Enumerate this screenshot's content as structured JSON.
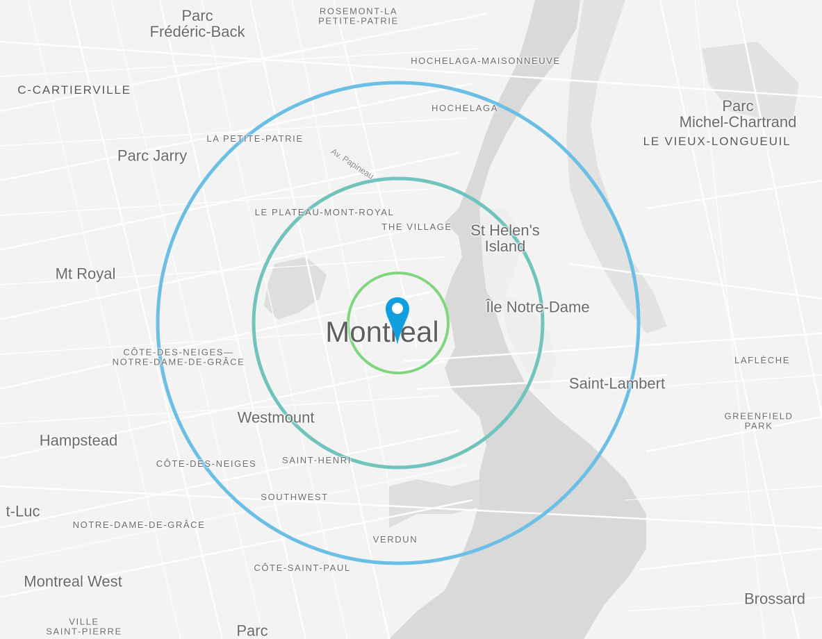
{
  "map": {
    "center_label": "Montreal",
    "labels": {
      "parc_frederic_back": "Parc\nFrédéric-Back",
      "rosemont": "ROSEMONT-LA\nPETITE-PATRIE",
      "hochelaga_maisonneuve": "HOCHELAGA-MAISONNEUVE",
      "cartierville": "C-CARTIERVILLE",
      "hochelaga": "HOCHELAGA",
      "parc_michel_chartrand": "Parc\nMichel-Chartrand",
      "vieux_longueuil": "LE VIEUX-LONGUEUIL",
      "la_petite_patrie": "LA PETITE-PATRIE",
      "av_papineau": "Av. Papineau",
      "parc_jarry": "Parc Jarry",
      "plateau": "LE PLATEAU-MONT-ROYAL",
      "the_village": "THE VILLAGE",
      "st_helens": "St Helen's\nIsland",
      "mt_royal": "Mt Royal",
      "ile_notre_dame": "Île Notre-Dame",
      "cdn_ndg": "CÔTE-DES-NEIGES—\nNOTRE-DAME-DE-GRÂCE",
      "lafleche": "LAFLÈCHE",
      "saint_lambert": "Saint-Lambert",
      "westmount": "Westmount",
      "greenfield_park": "GREENFIELD\nPARK",
      "hampstead": "Hampstead",
      "cote_des_neiges": "CÔTE-DES-NEIGES",
      "saint_henri": "SAINT-HENRI",
      "southwest": "SOUTHWEST",
      "luc": "t-Luc",
      "ndg": "NOTRE-DAME-DE-GRÂCE",
      "verdun": "VERDUN",
      "cote_saint_paul": "CÔTE-SAINT-PAUL",
      "montreal_west": "Montreal West",
      "brossard": "Brossard",
      "ville_saint_pierre": "VILLE\nSAINT-PIERRE",
      "parc_bottom": "Parc"
    },
    "rings": [
      {
        "name": "inner-ring",
        "color": "#7fd67f"
      },
      {
        "name": "middle-ring",
        "color": "#70c4bd"
      },
      {
        "name": "outer-ring",
        "color": "#6cbfe4"
      }
    ],
    "pin_color": "#119fe0",
    "water_color": "#d7d7d7",
    "park_color": "#dfdfdf",
    "road_color": "#ffffff",
    "icons": {
      "pin": "location-pin-icon"
    }
  }
}
